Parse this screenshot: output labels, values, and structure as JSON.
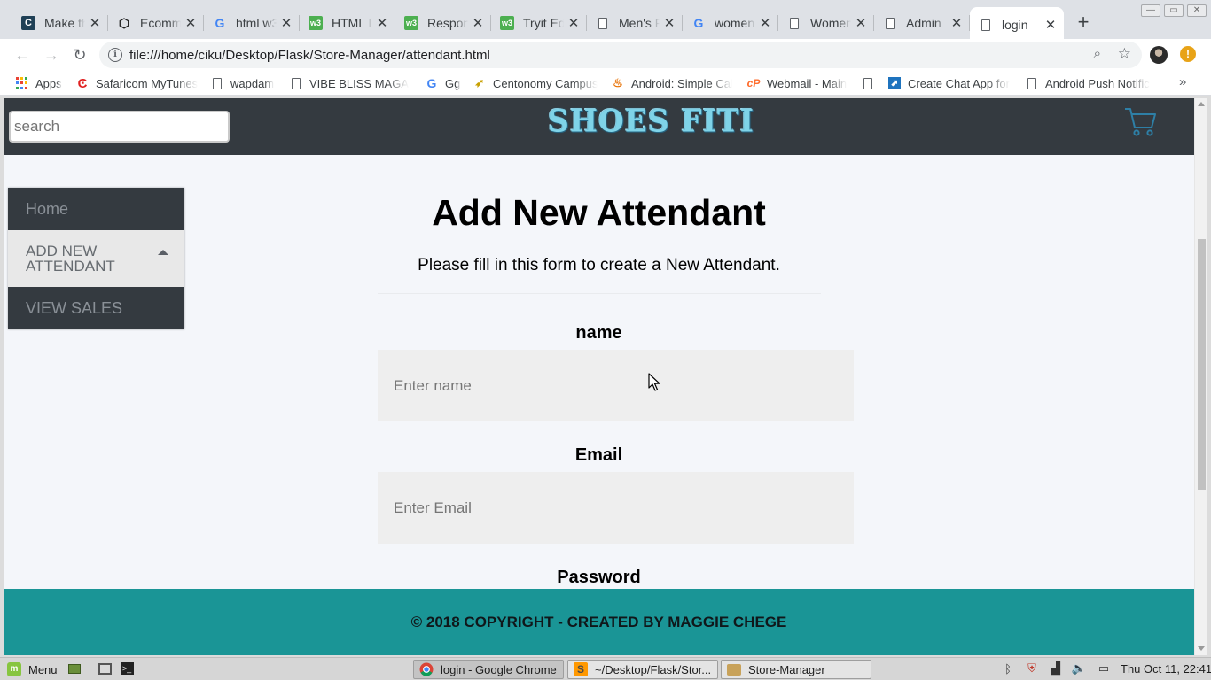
{
  "browser": {
    "tabs": [
      {
        "title": "Make th",
        "icon": "codecademy-icon"
      },
      {
        "title": "Ecommerce",
        "icon": "codepen-icon"
      },
      {
        "title": "html w3",
        "icon": "google-icon"
      },
      {
        "title": "HTML List",
        "icon": "w3-icon"
      },
      {
        "title": "Responsive",
        "icon": "w3-icon"
      },
      {
        "title": "Tryit Editor",
        "icon": "w3-icon"
      },
      {
        "title": "Men's F",
        "icon": "page-icon"
      },
      {
        "title": "women",
        "icon": "google-icon"
      },
      {
        "title": "Women",
        "icon": "page-icon"
      },
      {
        "title": "Admin",
        "icon": "page-icon"
      },
      {
        "title": "login",
        "icon": "page-icon",
        "active": true
      }
    ],
    "url": "file:///home/ciku/Desktop/Flask/Store-Manager/attendant.html",
    "bookmarks": [
      {
        "label": "Apps",
        "icon": "apps-grid-icon"
      },
      {
        "label": "Safaricom MyTunes",
        "icon": "safaricom-icon"
      },
      {
        "label": "wapdam",
        "icon": "page-icon"
      },
      {
        "label": "VIBE BLISS MAGAZINE",
        "icon": "page-icon"
      },
      {
        "label": "Gg",
        "icon": "google-icon"
      },
      {
        "label": "Centonomy Campus",
        "icon": "centonomy-icon"
      },
      {
        "label": "Android: Simple Calc",
        "icon": "java-icon"
      },
      {
        "label": "Webmail - Main",
        "icon": "cpanel-icon"
      },
      {
        "label": "",
        "icon": "page-icon"
      },
      {
        "label": "Create Chat App for",
        "icon": "chat-app-icon"
      },
      {
        "label": "Android Push Notific",
        "icon": "page-icon"
      }
    ]
  },
  "site": {
    "search_placeholder": "search",
    "logo_text": "SHOES FITI",
    "nav": [
      {
        "label": "Home"
      },
      {
        "label": "ADD NEW ATTENDANT",
        "open": true
      },
      {
        "label": "VIEW SALES"
      }
    ],
    "page_title": "Add New Attendant",
    "subtitle": "Please fill in this form to create a New Attendant.",
    "form": {
      "name_label": "name",
      "name_placeholder": "Enter name",
      "email_label": "Email",
      "email_placeholder": "Enter Email",
      "password_label": "Password"
    },
    "footer_text": "© 2018 COPYRIGHT - CREATED BY MAGGIE CHEGE",
    "colors": {
      "header_bg": "#343a40",
      "footer_bg": "#1a9596",
      "page_bg": "#f4f6fa"
    }
  },
  "taskbar": {
    "menu_label": "Menu",
    "tasks": [
      {
        "label": "login - Google Chrome",
        "icon": "chrome-icon",
        "active": true
      },
      {
        "label": "~/Desktop/Flask/Stor...",
        "icon": "sublime-icon"
      },
      {
        "label": "Store-Manager",
        "icon": "folder-icon"
      }
    ],
    "clock": "Thu Oct 11, 22:41"
  }
}
